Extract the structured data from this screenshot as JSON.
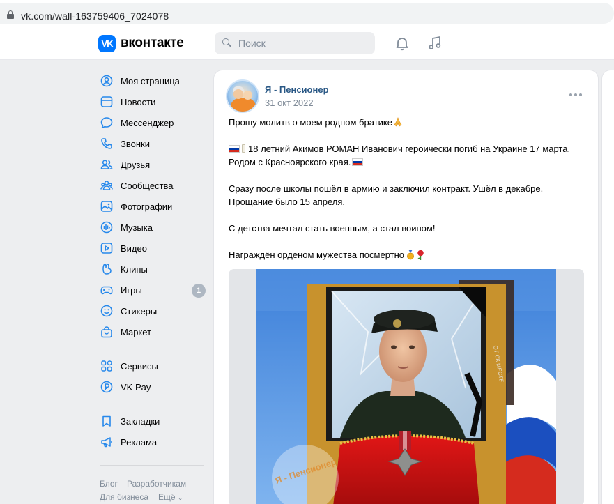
{
  "browser": {
    "url": "vk.com/wall-163759406_7024078"
  },
  "header": {
    "logo_mark": "VK",
    "logo_text": "вконтакте",
    "search_placeholder": "Поиск"
  },
  "sidebar": {
    "items": [
      {
        "label": "Моя страница",
        "icon": "user-circle-icon"
      },
      {
        "label": "Новости",
        "icon": "newsfeed-icon"
      },
      {
        "label": "Мессенджер",
        "icon": "message-bubble-icon"
      },
      {
        "label": "Звонки",
        "icon": "phone-icon"
      },
      {
        "label": "Друзья",
        "icon": "friends-icon"
      },
      {
        "label": "Сообщества",
        "icon": "communities-icon"
      },
      {
        "label": "Фотографии",
        "icon": "photo-icon"
      },
      {
        "label": "Музыка",
        "icon": "music-icon"
      },
      {
        "label": "Видео",
        "icon": "video-icon"
      },
      {
        "label": "Клипы",
        "icon": "clips-icon"
      },
      {
        "label": "Игры",
        "icon": "gamepad-icon",
        "badge": "1"
      },
      {
        "label": "Стикеры",
        "icon": "smile-icon"
      },
      {
        "label": "Маркет",
        "icon": "market-bag-icon"
      }
    ],
    "services": [
      {
        "label": "Сервисы",
        "icon": "services-grid-icon"
      },
      {
        "label": "VK Pay",
        "icon": "vkpay-icon"
      }
    ],
    "extras": [
      {
        "label": "Закладки",
        "icon": "bookmark-icon"
      },
      {
        "label": "Реклама",
        "icon": "megaphone-icon"
      }
    ],
    "footer": {
      "blog": "Блог",
      "developers": "Разработчикам",
      "business": "Для бизнеса",
      "more": "Ещё"
    }
  },
  "post": {
    "author": "Я - Пенсионер",
    "date": "31 окт 2022",
    "lines": {
      "l1": "Прошу молитв о моем родном братике",
      "l2": "18 летний Акимов РОМАН Иванович героически погиб на Украине 17 марта.",
      "l3": "Родом с Красноярского края.",
      "l4": "Сразу после школы пошёл в армию и заключил контракт. Ушёл в декабре.",
      "l5": "Прощание было 15 апреля.",
      "l6": "С детства мечтал стать военным, а стал воином!",
      "l7": "Награждён орденом мужества посмертно"
    },
    "photo": {
      "watermark": "Я - Пенсионер",
      "ribbon_text": "ОТ СК МЕСТЕ"
    }
  },
  "colors": {
    "vk_blue": "#0077ff",
    "link": "#2a5885",
    "secondary_text": "#818c99",
    "page_bg": "#edeef0"
  }
}
